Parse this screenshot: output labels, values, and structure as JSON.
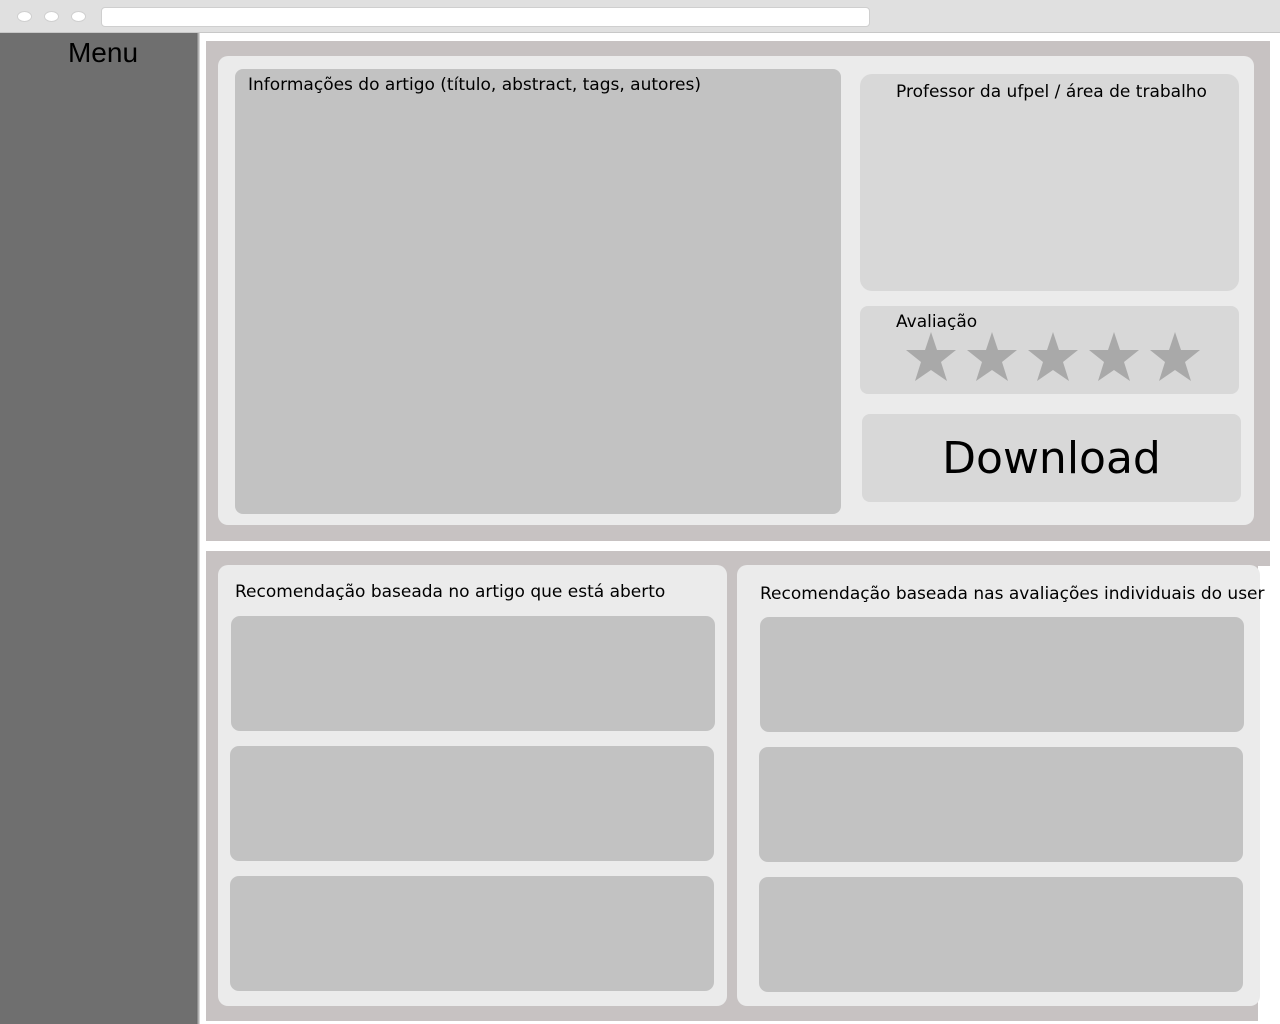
{
  "sidebar": {
    "title": "Menu"
  },
  "article": {
    "label": "Informações do artigo (título, abstract, tags, autores)"
  },
  "professor": {
    "label": "Professor da ufpel / área de trabalho"
  },
  "rating": {
    "label": "Avaliação",
    "stars_total": 5,
    "stars_filled": 5,
    "star_color": "#a9a9a9"
  },
  "download": {
    "label": "Download"
  },
  "recommendations": {
    "by_article": {
      "label": "Recomendação baseada no artigo que está aberto",
      "items": 3
    },
    "by_user": {
      "label": "Recomendação baseada nas avaliações individuais do user",
      "items": 3
    }
  }
}
